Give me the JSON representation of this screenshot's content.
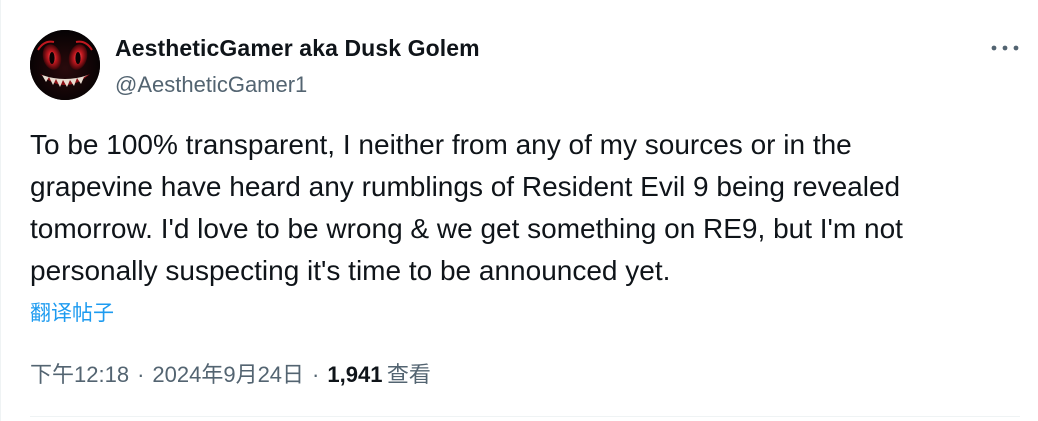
{
  "tweet": {
    "avatar": {
      "icon": "grinning-demon-face-avatar",
      "colors": {
        "background": "#050203",
        "accent": "#c2181f",
        "eye_glow": "#ff4b4b"
      }
    },
    "author": {
      "display_name": "AestheticGamer aka Dusk Golem",
      "handle": "@AestheticGamer1"
    },
    "more_icon": "more-horizontal-icon",
    "text_lines": [
      "To be 100% transparent, I neither from any of my sources or in the",
      "grapevine have heard any rumblings of Resident Evil 9 being revealed",
      "tomorrow. I'd love to be wrong & we get something on RE9, but I'm not",
      "personally suspecting it's time to be announced yet."
    ],
    "translate_label": "翻译帖子",
    "meta": {
      "time": "下午12:18",
      "separator": "·",
      "date": "2024年9月24日",
      "view_count": "1,941",
      "view_label": "查看"
    },
    "colors": {
      "text": "#0f1419",
      "secondary": "#536471",
      "link": "#1d9bf0",
      "border": "#eff3f4"
    }
  }
}
